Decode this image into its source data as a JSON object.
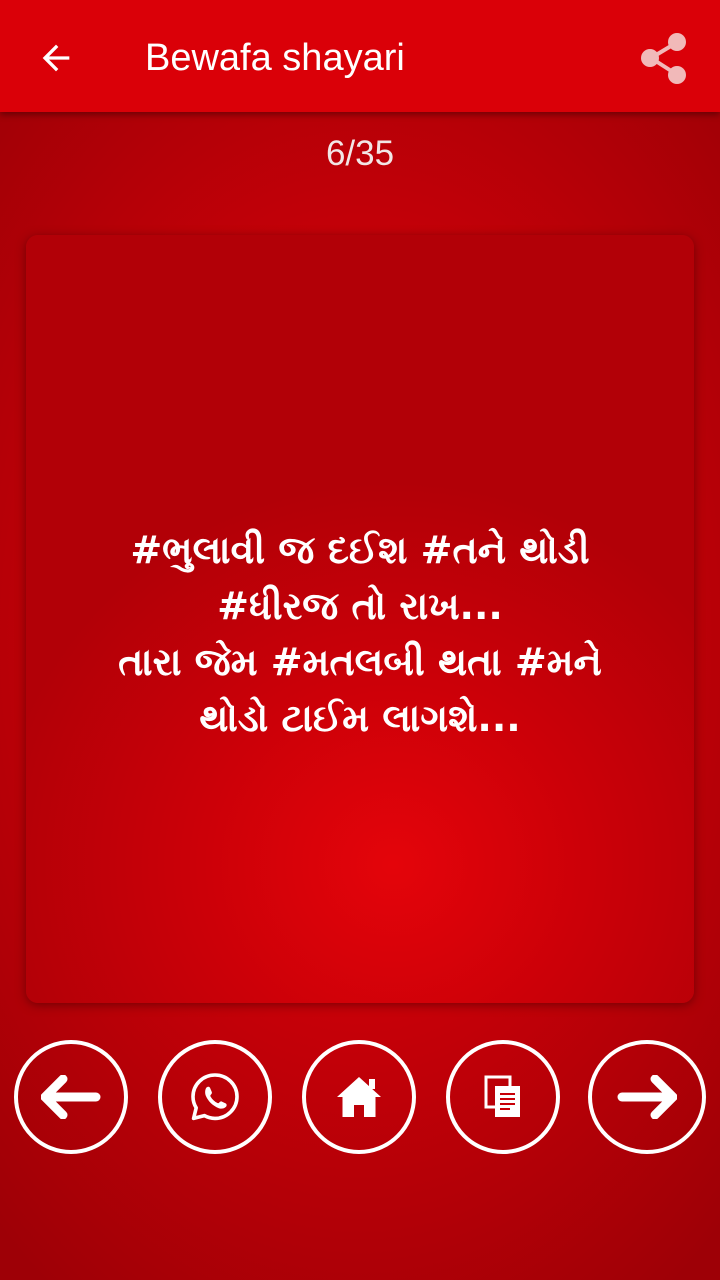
{
  "appbar": {
    "title": "Bewafa shayari",
    "back_icon": "arrow-left-icon",
    "share_icon": "share-icon",
    "background_color": "#da0008"
  },
  "pager": {
    "current": 6,
    "total": 35,
    "text": "6/35"
  },
  "quote": {
    "text": "#ભુલાવી જ દઈશ #તને થોડી\n#ધીરજ તો રાખ...\nતારા જેમ #મતલબી થતા #મને\nથોડો ટાઈમ લાગશે..."
  },
  "actions": [
    {
      "name": "previous",
      "icon": "arrow-left-icon"
    },
    {
      "name": "whatsapp",
      "icon": "whatsapp-icon"
    },
    {
      "name": "home",
      "icon": "home-icon"
    },
    {
      "name": "copy",
      "icon": "copy-icon"
    },
    {
      "name": "next",
      "icon": "arrow-right-icon"
    }
  ],
  "colors": {
    "background": "#c80008",
    "text": "#ffffff"
  }
}
